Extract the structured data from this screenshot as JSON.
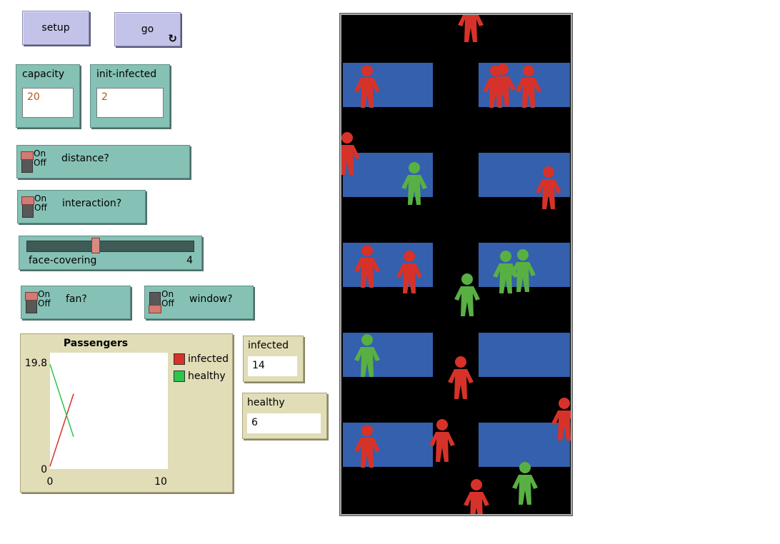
{
  "buttons": {
    "setup": "setup",
    "go": "go",
    "go_icon": "forever-icon"
  },
  "inputs": {
    "capacity": {
      "label": "capacity",
      "value": "20"
    },
    "init_infected": {
      "label": "init-infected",
      "value": "2"
    }
  },
  "switches": {
    "distance": {
      "label": "distance?",
      "on": "On",
      "off": "Off",
      "state": "off"
    },
    "interaction": {
      "label": "interaction?",
      "on": "On",
      "off": "Off",
      "state": "off"
    },
    "fan": {
      "label": "fan?",
      "on": "On",
      "off": "Off",
      "state": "off"
    },
    "window": {
      "label": "window?",
      "on": "On",
      "off": "Off",
      "state": "off"
    }
  },
  "slider": {
    "label": "face-covering",
    "value": "4",
    "fraction": 0.4
  },
  "plot": {
    "title": "Passengers",
    "y_max_label": "19.8",
    "y_min_label": "0",
    "x_min_label": "0",
    "x_max_label": "10",
    "legend": [
      {
        "name": "infected",
        "color": "#d73229"
      },
      {
        "name": "healthy",
        "color": "#2cc64a"
      }
    ]
  },
  "chart_data": {
    "type": "line",
    "title": "Passengers",
    "xlim": [
      0,
      10
    ],
    "ylim": [
      0,
      19.8
    ],
    "series": [
      {
        "name": "infected",
        "color": "#d73229",
        "x": [
          0,
          2
        ],
        "y": [
          0.5,
          14
        ]
      },
      {
        "name": "healthy",
        "color": "#2cc64a",
        "x": [
          0,
          2
        ],
        "y": [
          19.5,
          6
        ]
      }
    ]
  },
  "monitors": {
    "infected": {
      "label": "infected",
      "value": "14"
    },
    "healthy": {
      "label": "healthy",
      "value": "6"
    }
  },
  "world": {
    "background": "#000000",
    "seat_color": "#3460ad",
    "infected_color": "#d73229",
    "healthy_color": "#58b043"
  }
}
